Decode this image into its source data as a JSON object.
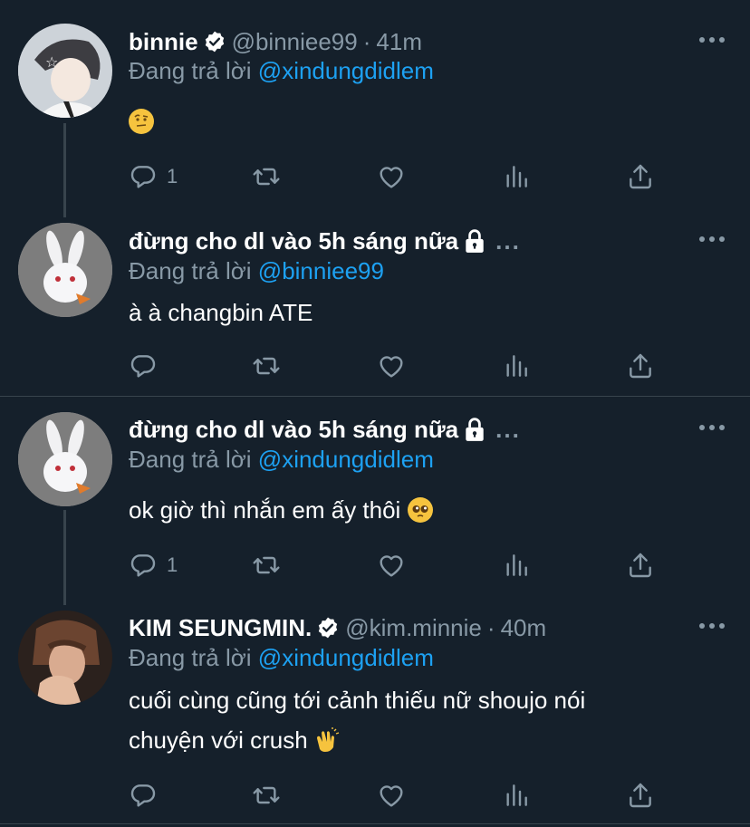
{
  "colors": {
    "background": "#15202b",
    "secondary_text": "#8899a6",
    "mention": "#1da1f2",
    "divider": "#38444d"
  },
  "tweets": [
    {
      "name": "binnie",
      "verified": true,
      "handle": "@binniee99",
      "sep": "·",
      "time": "41m",
      "reply_prefix": "Đang trả lời",
      "reply_mention": "@xindungdidlem",
      "text": "",
      "emoji": "face-with-raised-eyebrow",
      "reply_count": "1"
    },
    {
      "name": "đừng cho dl vào 5h sáng nữa",
      "locked": true,
      "handle_more": "...",
      "reply_prefix": "Đang trả lời",
      "reply_mention": "@binniee99",
      "text": "à à changbin ATE",
      "reply_count": ""
    },
    {
      "name": "đừng cho dl vào 5h sáng nữa",
      "locked": true,
      "handle_more": "...",
      "reply_prefix": "Đang trả lời",
      "reply_mention": "@xindungdidlem",
      "text": "ok giờ thì nhắn em ấy thôi",
      "emoji": "pleading-face",
      "reply_count": "1"
    },
    {
      "name": "KIM SEUNGMIN.",
      "verified": true,
      "handle": "@kim.minnie",
      "sep": "·",
      "time": "40m",
      "reply_prefix": "Đang trả lời",
      "reply_mention": "@xindungdidlem",
      "text_line1": "cuối cùng cũng tới cảnh thiếu nữ shoujo nói",
      "text_line2": "chuyện với crush",
      "emoji": "clapping-hands",
      "reply_count": ""
    }
  ],
  "icons": {
    "reply": "reply-icon",
    "retweet": "retweet-icon",
    "like": "heart-icon",
    "analytics": "analytics-icon",
    "share": "share-icon",
    "more": "more-icon",
    "verified": "verified-badge-icon",
    "lock": "lock-icon"
  }
}
